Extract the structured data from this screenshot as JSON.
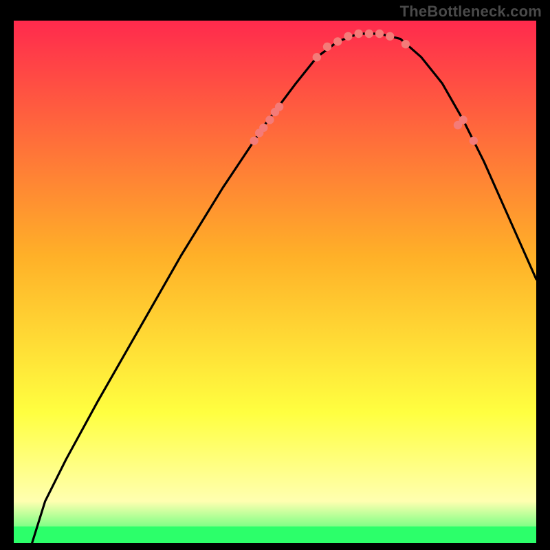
{
  "watermark": "TheBottleneck.com",
  "chart_data": {
    "type": "line",
    "title": "",
    "xlabel": "",
    "ylabel": "",
    "xlim": [
      0,
      100
    ],
    "ylim": [
      0,
      100
    ],
    "grid": false,
    "legend": false,
    "gradient_colors": {
      "top": "#ff2a4d",
      "upper_mid": "#ffb028",
      "lower_mid": "#ffff40",
      "pale_yellow": "#ffffb0",
      "bottom": "#2cff6a"
    },
    "green_band_y_frac": 0.968,
    "series": [
      {
        "name": "curve",
        "type": "line",
        "color": "#000000",
        "x": [
          3.5,
          6.0,
          10.0,
          16.0,
          24.0,
          32.0,
          40.0,
          48.0,
          54.0,
          58.0,
          62.0,
          66.0,
          70.0,
          74.0,
          78.0,
          82.0,
          86.0,
          90.0,
          94.0,
          98.0,
          100.0
        ],
        "y": [
          0.0,
          8.0,
          16.0,
          27.0,
          41.0,
          55.0,
          68.0,
          80.0,
          88.0,
          93.0,
          96.0,
          97.5,
          97.5,
          96.5,
          93.0,
          88.0,
          81.0,
          73.0,
          64.0,
          55.0,
          50.5
        ]
      },
      {
        "name": "markers",
        "type": "scatter",
        "color": "#f47b78",
        "x": [
          46.0,
          47.0,
          47.8,
          49.0,
          50.0,
          50.8,
          58.0,
          60.0,
          62.0,
          64.0,
          66.0,
          68.0,
          70.0,
          72.0,
          75.0,
          85.0,
          86.0,
          88.0
        ],
        "y": [
          77.0,
          78.5,
          79.5,
          81.0,
          82.5,
          83.5,
          93.0,
          95.0,
          96.0,
          97.0,
          97.5,
          97.5,
          97.5,
          97.0,
          95.5,
          80.0,
          81.0,
          77.0
        ]
      }
    ]
  }
}
